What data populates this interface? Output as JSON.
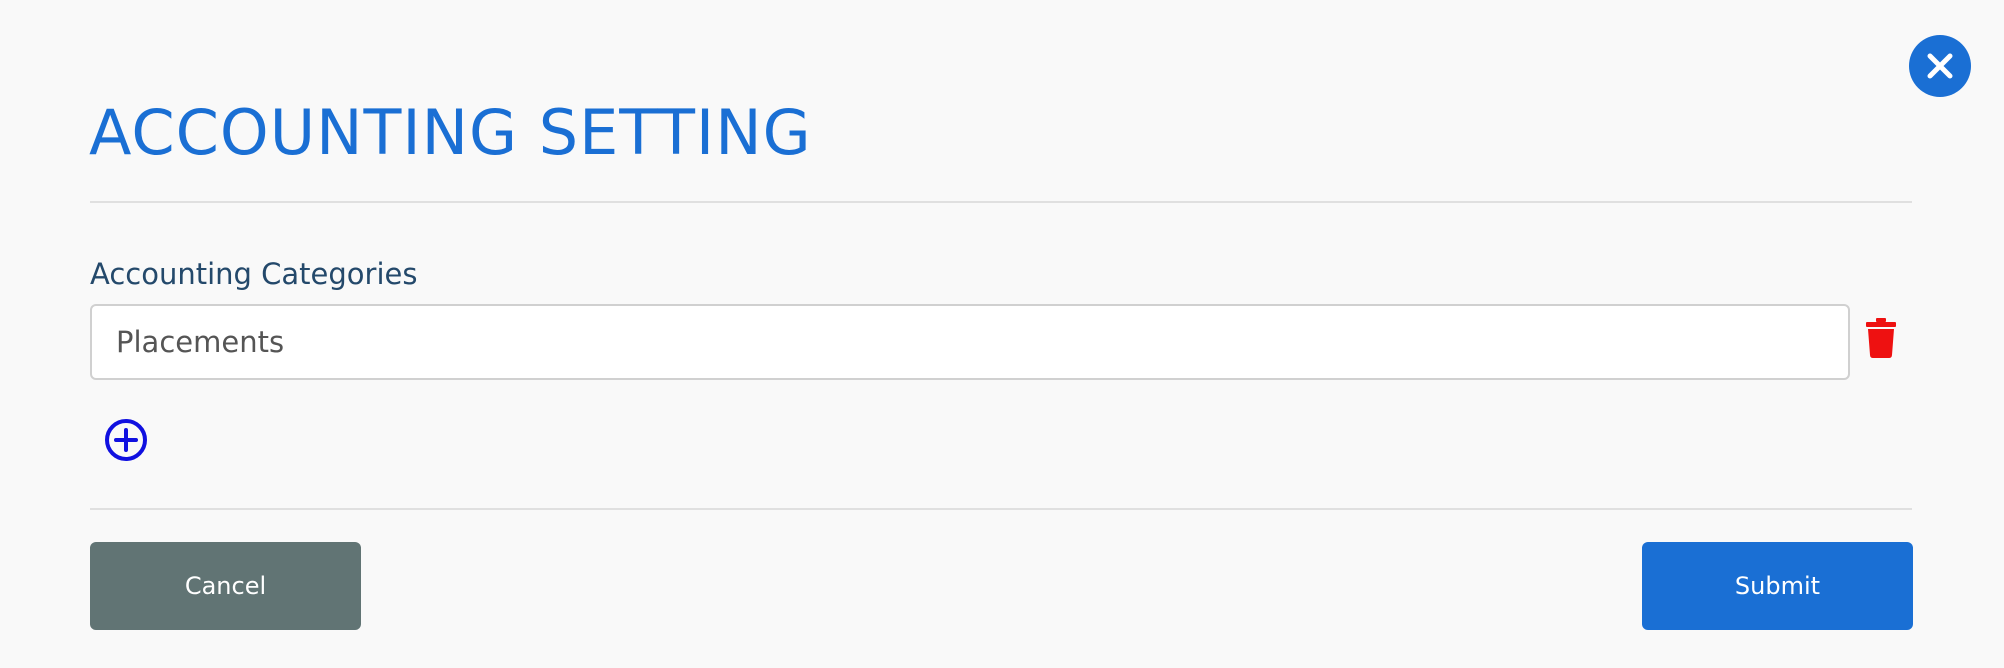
{
  "dialog": {
    "title": "ACCOUNTING SETTING",
    "close_icon": "close-icon"
  },
  "categories": {
    "label": "Accounting Categories",
    "items": [
      {
        "value": "Placements",
        "delete_icon": "trash-icon"
      }
    ],
    "add_icon": "plus-circle-icon"
  },
  "footer": {
    "cancel_label": "Cancel",
    "submit_label": "Submit"
  },
  "colors": {
    "primary": "#1a6fd4",
    "cancel": "#617474",
    "delete": "#ee1111",
    "add": "#1010e0",
    "label": "#24496b"
  }
}
